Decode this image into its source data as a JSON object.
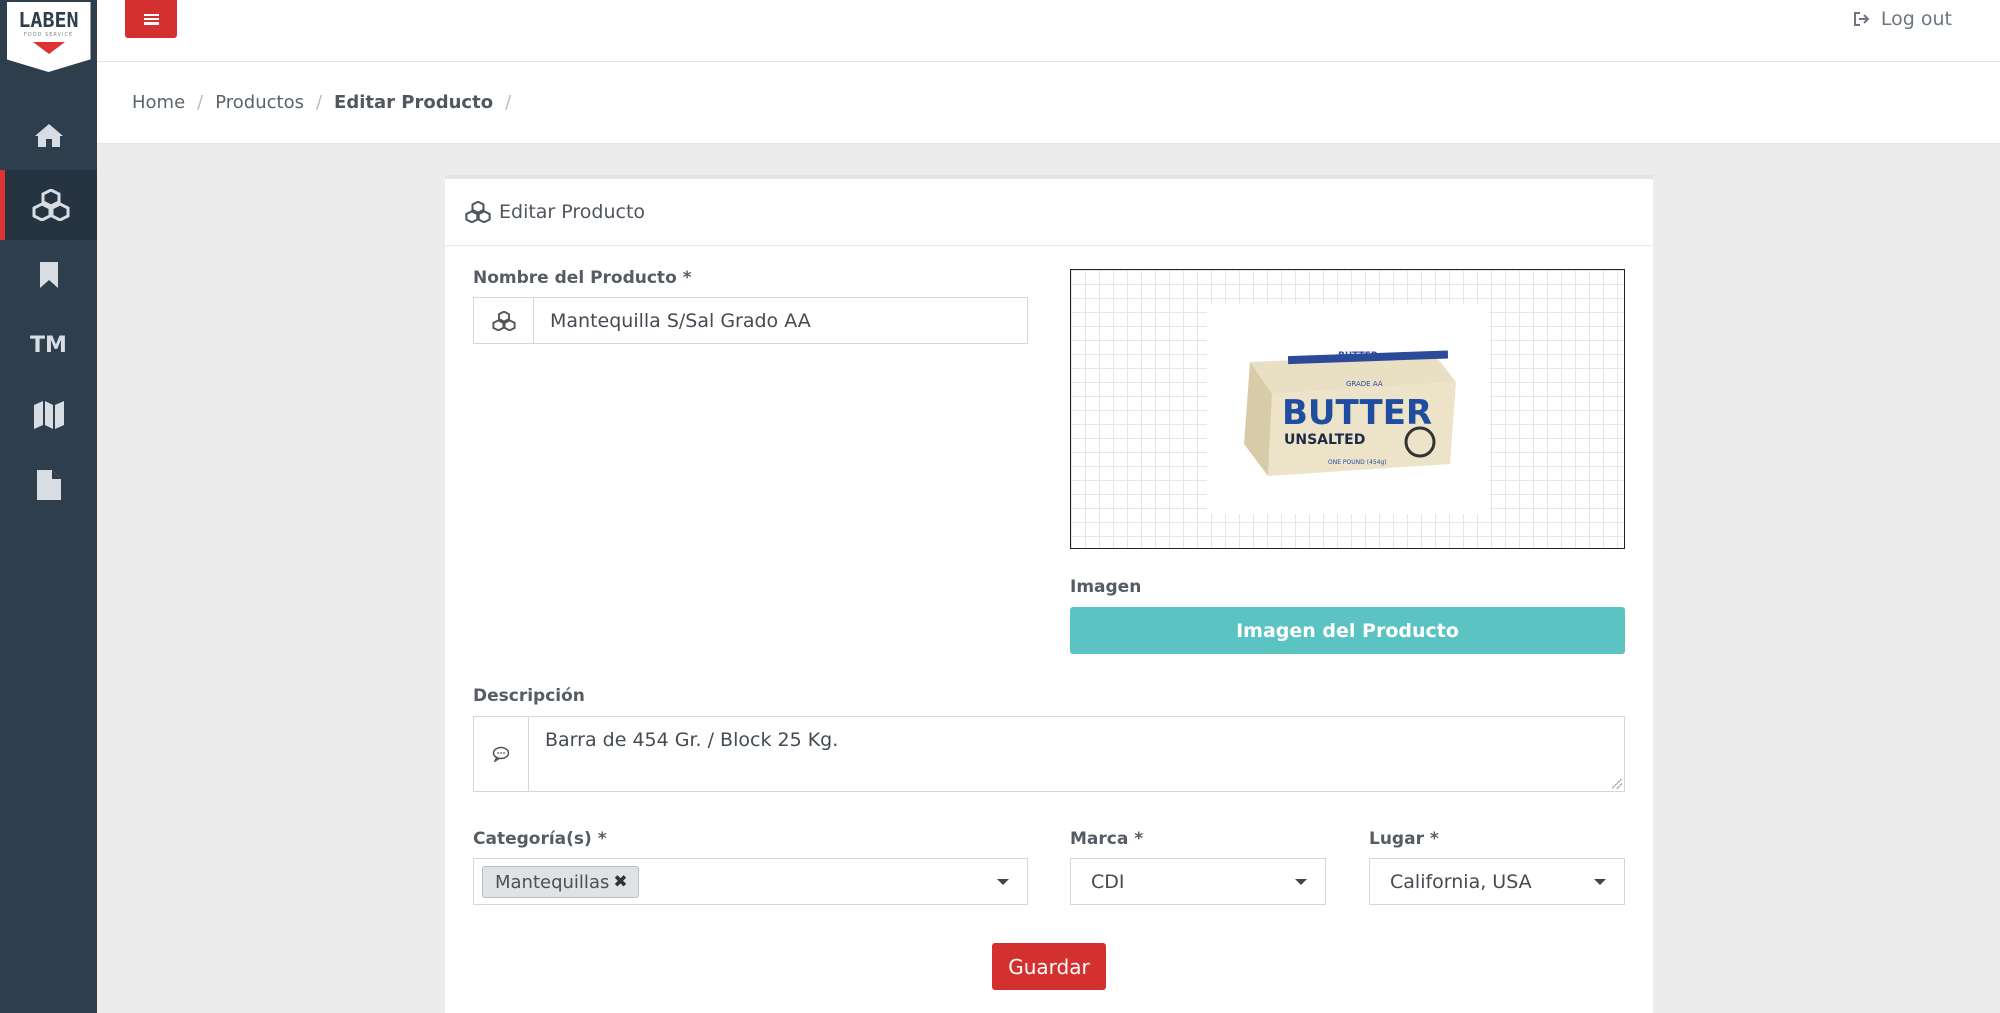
{
  "brand": {
    "logo_text": "LABEN",
    "logo_subtext": "FOOD SERVICE"
  },
  "sidebar": {
    "items": [
      {
        "name": "home",
        "icon": "home-icon",
        "active": false
      },
      {
        "name": "products",
        "icon": "cubes-icon",
        "active": true
      },
      {
        "name": "bookmarks",
        "icon": "bookmark-icon",
        "active": false
      },
      {
        "name": "brands",
        "label": "TM",
        "active": false
      },
      {
        "name": "places",
        "icon": "map-icon",
        "active": false
      },
      {
        "name": "documents",
        "icon": "file-icon",
        "active": false
      }
    ]
  },
  "topbar": {
    "logout_label": "Log out"
  },
  "breadcrumb": {
    "items": [
      "Home",
      "Productos",
      "Editar Producto"
    ],
    "trailing_separator": "/"
  },
  "card": {
    "title": "Editar Producto"
  },
  "form": {
    "name_label": "Nombre del Producto *",
    "name_value": "Mantequilla S/Sal Grado AA",
    "image_label": "Imagen",
    "image_button": "Imagen del Producto",
    "image_product": {
      "top_line": "BUTTER",
      "grade": "GRADE AA",
      "brand": "BUTTER",
      "variant": "UNSALTED",
      "weight": "ONE POUND (454g)"
    },
    "description_label": "Descripción",
    "description_value": "Barra de 454 Gr. / Block 25 Kg.",
    "category_label": "Categoría(s) *",
    "category_tags": [
      "Mantequillas"
    ],
    "tag_remove": "✖",
    "brand_label": "Marca *",
    "brand_value": "CDI",
    "place_label": "Lugar *",
    "place_value": "California, USA",
    "save_button": "Guardar"
  },
  "colors": {
    "sidebar_bg": "#2f3e4d",
    "accent_red": "#d3302f",
    "teal_button": "#5bc4c3"
  }
}
